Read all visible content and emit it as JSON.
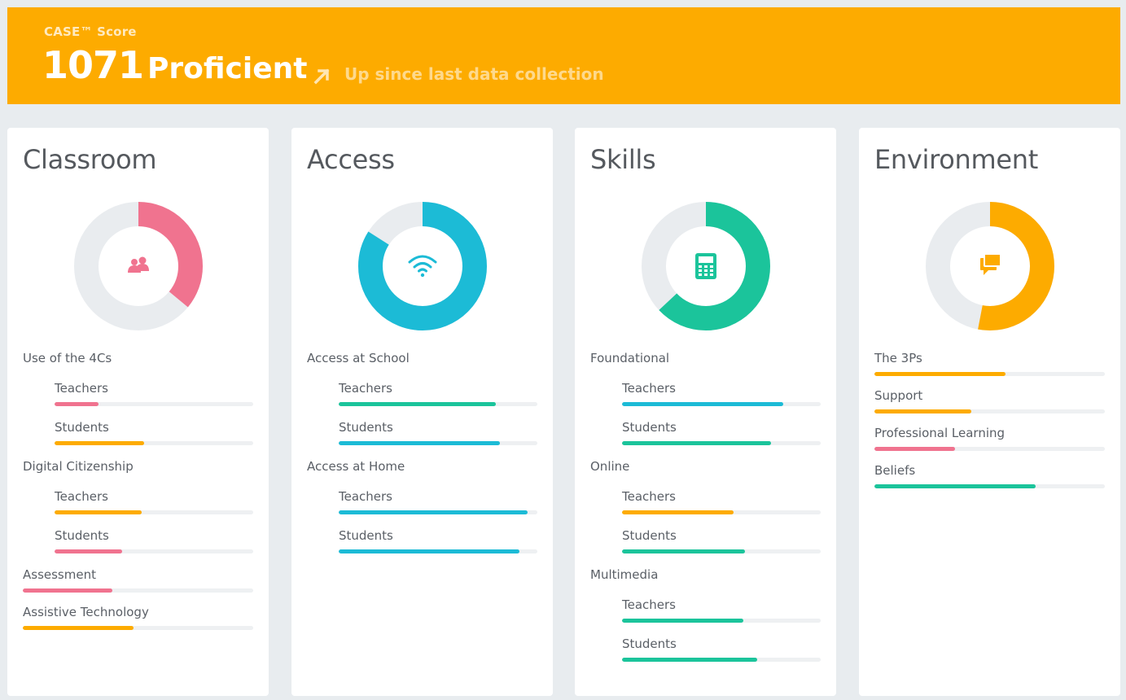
{
  "banner": {
    "case_label": "CASE™ Score",
    "score": "1071",
    "level": "Proficient",
    "trend": "Up since last data collection",
    "trend_icon": "arrow-up-right-icon"
  },
  "colors": {
    "banner": "#fdab00",
    "pink": "#f0738f",
    "blue": "#1cbbd6",
    "green": "#1bc49b",
    "orange": "#fdab00",
    "track": "#eef0f2",
    "ring_bg": "#e9ecef"
  },
  "cards": [
    {
      "title": "Classroom",
      "icon": "people-icon",
      "ring_color": "pink",
      "ring_fraction": 0.36,
      "rows": [
        {
          "label": "Use of the 4Cs",
          "kind": "header"
        },
        {
          "label": "Teachers",
          "kind": "sub",
          "value": 0.22,
          "color": "pink"
        },
        {
          "label": "Students",
          "kind": "sub",
          "value": 0.45,
          "color": "orange"
        },
        {
          "label": "Digital Citizenship",
          "kind": "header"
        },
        {
          "label": "Teachers",
          "kind": "sub",
          "value": 0.44,
          "color": "orange"
        },
        {
          "label": "Students",
          "kind": "sub",
          "value": 0.34,
          "color": "pink"
        },
        {
          "label": "Assessment",
          "kind": "item",
          "value": 0.39,
          "color": "pink"
        },
        {
          "label": "Assistive Technology",
          "kind": "item",
          "value": 0.48,
          "color": "orange"
        }
      ]
    },
    {
      "title": "Access",
      "icon": "wifi-icon",
      "ring_color": "blue",
      "ring_fraction": 0.84,
      "rows": [
        {
          "label": "Access at School",
          "kind": "header"
        },
        {
          "label": "Teachers",
          "kind": "sub",
          "value": 0.79,
          "color": "green"
        },
        {
          "label": "Students",
          "kind": "sub",
          "value": 0.81,
          "color": "blue"
        },
        {
          "label": "Access at Home",
          "kind": "header"
        },
        {
          "label": "Teachers",
          "kind": "sub",
          "value": 0.95,
          "color": "blue"
        },
        {
          "label": "Students",
          "kind": "sub",
          "value": 0.91,
          "color": "blue"
        }
      ]
    },
    {
      "title": "Skills",
      "icon": "calculator-icon",
      "ring_color": "green",
      "ring_fraction": 0.63,
      "rows": [
        {
          "label": "Foundational",
          "kind": "header"
        },
        {
          "label": "Teachers",
          "kind": "sub",
          "value": 0.81,
          "color": "blue"
        },
        {
          "label": "Students",
          "kind": "sub",
          "value": 0.75,
          "color": "green"
        },
        {
          "label": "Online",
          "kind": "header"
        },
        {
          "label": "Teachers",
          "kind": "sub",
          "value": 0.56,
          "color": "orange"
        },
        {
          "label": "Students",
          "kind": "sub",
          "value": 0.62,
          "color": "green"
        },
        {
          "label": "Multimedia",
          "kind": "header"
        },
        {
          "label": "Teachers",
          "kind": "sub",
          "value": 0.61,
          "color": "green"
        },
        {
          "label": "Students",
          "kind": "sub",
          "value": 0.68,
          "color": "green"
        }
      ]
    },
    {
      "title": "Environment",
      "icon": "chat-bubbles-icon",
      "ring_color": "orange",
      "ring_fraction": 0.53,
      "rows": [
        {
          "label": "The 3Ps",
          "kind": "item",
          "value": 0.57,
          "color": "orange"
        },
        {
          "label": "Support",
          "kind": "item",
          "value": 0.42,
          "color": "orange"
        },
        {
          "label": "Professional Learning",
          "kind": "item",
          "value": 0.35,
          "color": "pink"
        },
        {
          "label": "Beliefs",
          "kind": "item",
          "value": 0.7,
          "color": "green"
        }
      ]
    }
  ]
}
